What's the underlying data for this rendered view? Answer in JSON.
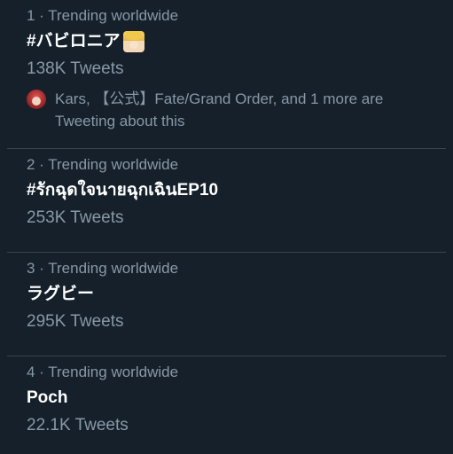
{
  "trends": [
    {
      "meta": "1 · Trending worldwide",
      "title": "#バビロニア",
      "count": "138K Tweets",
      "context_line1": "Kars, 【公式】Fate/Grand Order, and 1 more are",
      "context_line2": "Tweeting about this"
    },
    {
      "meta": "2 · Trending worldwide",
      "title": "#รักฉุดใจนายฉุกเฉินEP10",
      "count": "253K Tweets"
    },
    {
      "meta": "3 · Trending worldwide",
      "title": "ラグビー",
      "count": "295K Tweets"
    },
    {
      "meta": "4 · Trending worldwide",
      "title": "Poch",
      "count": "22.1K Tweets"
    }
  ],
  "colors": {
    "background": "#15202b",
    "secondary_text": "#8899a6",
    "divider": "#38444d"
  }
}
